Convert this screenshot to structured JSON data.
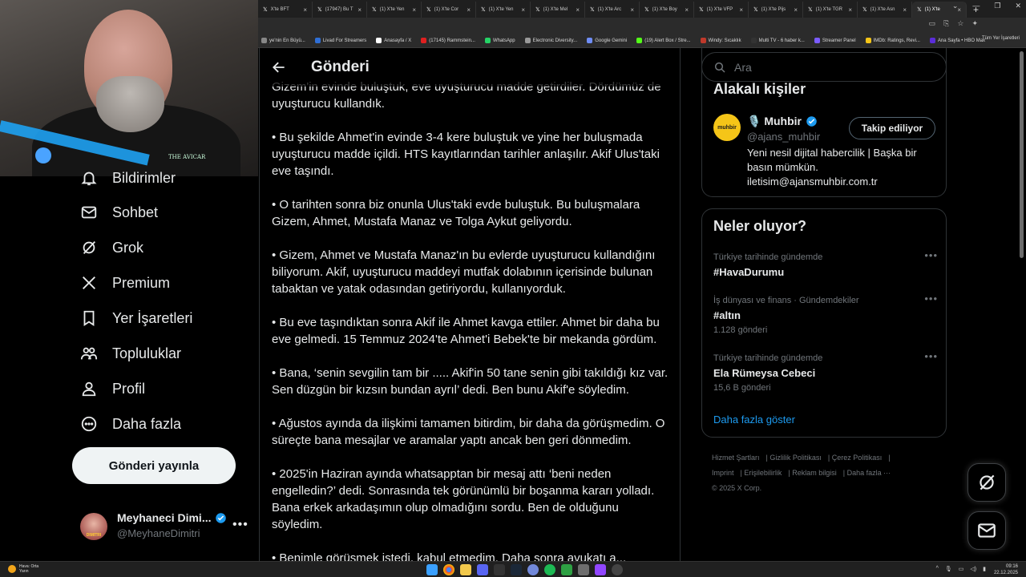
{
  "browser": {
    "tabs": [
      {
        "label": "X'te BFT",
        "active": false
      },
      {
        "label": "(17947) Bu T",
        "active": false
      },
      {
        "label": "(1) X'te Yen",
        "active": false
      },
      {
        "label": "(1) X'te Cor",
        "active": false
      },
      {
        "label": "(1) X'te Yen",
        "active": false
      },
      {
        "label": "(1) X'te Mel",
        "active": false
      },
      {
        "label": "(1) X'te Arc",
        "active": false
      },
      {
        "label": "(1) X'te Boy",
        "active": false
      },
      {
        "label": "(1) X'te VFP",
        "active": false
      },
      {
        "label": "(1) X'te Pijs",
        "active": false
      },
      {
        "label": "(1) X'te TGR",
        "active": false
      },
      {
        "label": "(1) X'te Asn",
        "active": false
      },
      {
        "label": "(1) X'te",
        "active": true
      }
    ],
    "bookmarks": [
      {
        "label": "ye'nin En Büyü...",
        "color": "#888888"
      },
      {
        "label": "Livad For Streamers",
        "color": "#2f6fd6"
      },
      {
        "label": "Anasayfa / X",
        "color": "#ffffff"
      },
      {
        "label": "(17145) Rammstein...",
        "color": "#e02020"
      },
      {
        "label": "WhatsApp",
        "color": "#25d366"
      },
      {
        "label": "Electronic Diversity...",
        "color": "#999999"
      },
      {
        "label": "Google Gemini",
        "color": "#6f8df7"
      },
      {
        "label": "(19) Alert Box / Stre...",
        "color": "#53fc18"
      },
      {
        "label": "Windy: Sıcaklık",
        "color": "#c0392b"
      },
      {
        "label": "Multi TV - 6 haber k...",
        "color": "#333333"
      },
      {
        "label": "Streamer Panel",
        "color": "#7b5cff"
      },
      {
        "label": "IMDb: Ratings, Revi...",
        "color": "#f5c518"
      },
      {
        "label": "Ana Sayfa • HBO Max",
        "color": "#5b2dd9"
      }
    ],
    "bookmarks_right": "Tüm Yer İşaretleri"
  },
  "sidebar": {
    "items": [
      {
        "label": "Bildirimler",
        "icon": "bell-icon"
      },
      {
        "label": "Sohbet",
        "icon": "mail-icon"
      },
      {
        "label": "Grok",
        "icon": "grok-icon"
      },
      {
        "label": "Premium",
        "icon": "x-logo-icon"
      },
      {
        "label": "Yer İşaretleri",
        "icon": "bookmark-icon"
      },
      {
        "label": "Topluluklar",
        "icon": "communities-icon"
      },
      {
        "label": "Profil",
        "icon": "profile-icon"
      },
      {
        "label": "Daha fazla",
        "icon": "more-circle-icon"
      }
    ],
    "post_button": "Gönderi yayınla",
    "profile": {
      "name": "Meyhaneci Dimi...",
      "handle": "@MeyhaneDimitri",
      "avatar_text": "DIMITRI"
    }
  },
  "webcam": {
    "logo_text": "THE AVICAR"
  },
  "main": {
    "title": "Gönderi",
    "paragraphs": [
      "Gizem'in evinde buluştuk, eve uyuşturucu madde getirdiler. Dördümüz de uyuşturucu kullandık.",
      "• Bu şekilde Ahmet'in evinde 3-4 kere buluştuk ve yine her buluşmada uyuşturucu madde içildi. HTS kayıtlarından tarihler anlaşılır. Akif Ulus'taki eve taşındı.",
      "• O tarihten sonra biz onunla Ulus'taki evde buluştuk. Bu buluşmalara Gizem, Ahmet, Mustafa Manaz ve Tolga Aykut geliyordu.",
      "• Gizem, Ahmet ve Mustafa Manaz'ın bu evlerde uyuşturucu kullandığını biliyorum. Akif, uyuşturucu maddeyi mutfak dolabının içerisinde bulunan tabaktan ve yatak odasından getiriyordu, kullanıyorduk.",
      "• Bu eve taşındıktan sonra Akif ile Ahmet kavga ettiler. Ahmet bir daha bu eve gelmedi. 15 Temmuz 2024'te Ahmet'i Bebek'te bir mekanda gördüm.",
      "• Bana, ‘senin sevgilin tam bir ..... Akif'in 50 tane senin gibi takıldığı kız var. Sen düzgün bir kızsın bundan ayrıl’ dedi. Ben bunu Akif'e söyledim.",
      "• Ağustos ayında da ilişkimi tamamen bitirdim, bir daha da görüşmedim. O süreçte bana mesajlar ve aramalar yaptı ancak ben geri dönmedim.",
      "• 2025'in Haziran ayında whatsapptan bir mesaj attı ‘beni neden engelledin?’ dedi. Sonrasında tek görünümlü bir boşanma kararı yolladı. Bana erkek arkadaşımın olup olmadığını sordu. Ben de olduğunu söyledim.",
      "• Benimle görüşmek istedi, kabul etmedim. Daha sonra avukatı a..."
    ]
  },
  "right": {
    "search_placeholder": "Ara",
    "related": {
      "title": "Alakalı kişiler",
      "name": "🎙️ Muhbir",
      "handle": "@ajans_muhbir",
      "avatar_text": "muhbir",
      "follow_label": "Takip ediliyor",
      "bio": "Yeni nesil dijital habercilik | Başka bir basın mümkün. iletisim@ajansmuhbir.com.tr"
    },
    "trends": {
      "title": "Neler oluyor?",
      "items": [
        {
          "category": "Türkiye tarihinde gündemde",
          "name": "#HavaDurumu",
          "count": ""
        },
        {
          "category": "İş dünyası ve finans · Gündemdekiler",
          "name": "#altın",
          "count": "1.128 gönderi"
        },
        {
          "category": "Türkiye tarihinde gündemde",
          "name": "Ela Rümeysa Cebeci",
          "count": "15,6 B gönderi"
        }
      ],
      "show_more": "Daha fazla göster"
    },
    "footer": [
      "Hizmet Şartları",
      "Gizlilik Politikası",
      "Çerez Politikası",
      "Imprint",
      "Erişilebilirlik",
      "Reklam bilgisi",
      "Daha fazla ···",
      "© 2025 X Corp."
    ]
  },
  "taskbar": {
    "weather_title": "Hava: Orta",
    "weather_sub": "Yarın",
    "time": "09:16",
    "date": "22.12.2025"
  },
  "colors": {
    "accent": "#1d9bf0",
    "background": "#000000",
    "border": "#2f3336",
    "muted": "#71767b"
  }
}
